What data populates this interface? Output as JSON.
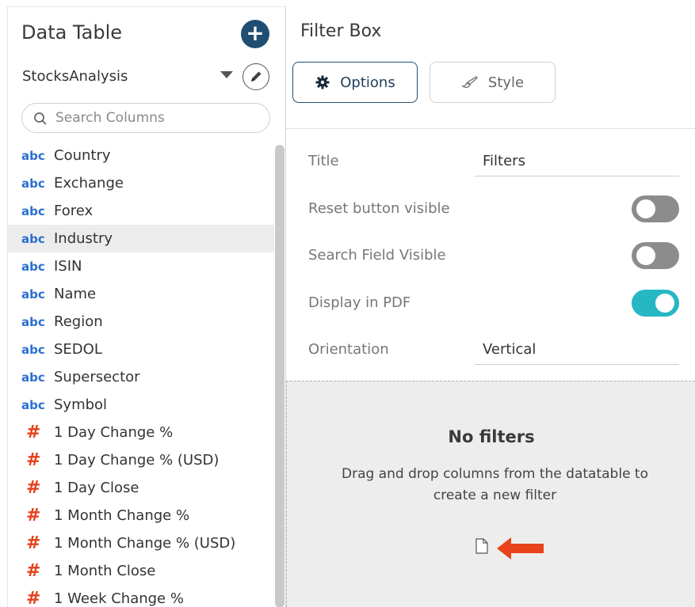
{
  "left_panel": {
    "title": "Data Table",
    "add_label": "+",
    "datasource": "StocksAnalysis",
    "search_placeholder": "Search Columns",
    "columns": [
      {
        "type": "abc",
        "name": "Country"
      },
      {
        "type": "abc",
        "name": "Exchange"
      },
      {
        "type": "abc",
        "name": "Forex"
      },
      {
        "type": "abc",
        "name": "Industry",
        "selected": true
      },
      {
        "type": "abc",
        "name": "ISIN"
      },
      {
        "type": "abc",
        "name": "Name"
      },
      {
        "type": "abc",
        "name": "Region"
      },
      {
        "type": "abc",
        "name": "SEDOL"
      },
      {
        "type": "abc",
        "name": "Supersector"
      },
      {
        "type": "abc",
        "name": "Symbol"
      },
      {
        "type": "#",
        "name": "1 Day Change %"
      },
      {
        "type": "#",
        "name": "1 Day Change % (USD)"
      },
      {
        "type": "#",
        "name": "1 Day Close"
      },
      {
        "type": "#",
        "name": "1 Month Change %"
      },
      {
        "type": "#",
        "name": "1 Month Change % (USD)"
      },
      {
        "type": "#",
        "name": "1 Month Close"
      },
      {
        "type": "#",
        "name": "1 Week Change %"
      }
    ]
  },
  "right_panel": {
    "title": "Filter Box",
    "tabs": {
      "options": "Options",
      "style": "Style"
    },
    "properties": {
      "title_label": "Title",
      "title_value": "Filters",
      "reset_label": "Reset button visible",
      "reset_on": false,
      "search_label": "Search Field Visible",
      "search_on": false,
      "pdf_label": "Display in PDF",
      "pdf_on": true,
      "orientation_label": "Orientation",
      "orientation_value": "Vertical"
    },
    "empty_state": {
      "title": "No filters",
      "description": "Drag and drop columns from the datatable to create a new filter"
    }
  },
  "colors": {
    "accent": "#1f4e72",
    "toggle_on": "#25b7c3",
    "toggle_off": "#8c8c8c",
    "text_type": "#2a6fd0",
    "numeric_type": "#e5401a",
    "arrow": "#e8431a"
  },
  "icons": {
    "add": "plus-icon",
    "dropdown": "caret-down-icon",
    "edit": "pencil-icon",
    "search": "search-icon",
    "options": "gear-icon",
    "style": "brush-icon",
    "file": "document-icon",
    "pointer": "arrow-left-icon"
  }
}
